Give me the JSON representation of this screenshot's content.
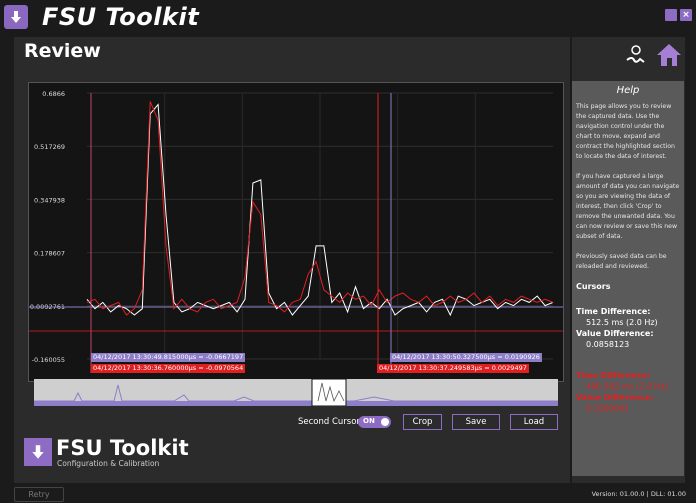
{
  "app": {
    "title": "FSU Toolkit"
  },
  "page": {
    "title": "Review"
  },
  "help": {
    "title": "Help",
    "paragraphs": [
      "This page allows you to review the captured data. Use the navigation control under the chart to move, expand and contract the highlighted section to locate the data of interest.",
      "If you have captured a large amount of data you can navigate so you are viewing the data of interest, then click 'Crop' to remove the unwanted data. You can now review or save this new subset of data.",
      "Previously saved data can be reloaded and reviewed."
    ]
  },
  "cursors": {
    "heading": "Cursors",
    "white": {
      "time_label": "Time Difference:",
      "time_value": "512.5 ms (2.0 Hz)",
      "value_label": "Value Difference:",
      "value_value": "0.0858123"
    },
    "red": {
      "time_label": "Time Difference:",
      "time_value": "480.583 ms (2.0 Hz)",
      "value_label": "Value Difference:",
      "value_value": "0.1000061"
    }
  },
  "chart_data": {
    "type": "line",
    "y_ticks": [
      "0.6866",
      "0.517269",
      "0.347938",
      "0.178607",
      "0.0092761",
      "-0.160055"
    ],
    "ylim": [
      -0.160055,
      0.6866
    ],
    "grid": true,
    "series": [
      {
        "color": "#ffffff",
        "values": [
          0.03,
          0.0,
          0.02,
          -0.01,
          0.01,
          0.0,
          -0.02,
          0.0,
          0.62,
          0.65,
          0.3,
          0.02,
          -0.01,
          0.0,
          0.02,
          0.01,
          0.0,
          0.01,
          0.02,
          -0.01,
          0.03,
          0.4,
          0.41,
          0.05,
          0.0,
          0.02,
          -0.02,
          0.01,
          0.04,
          0.2,
          0.2,
          0.02,
          0.05,
          -0.01,
          0.07,
          0.0,
          0.02,
          0.0,
          0.03,
          -0.02,
          0.0,
          0.01,
          0.02,
          -0.01,
          0.02,
          0.03,
          -0.02,
          0.04,
          0.03,
          0.01,
          0.02,
          0.03,
          0.0,
          0.02,
          0.01,
          0.03,
          0.02,
          0.04,
          0.01,
          0.02
        ]
      },
      {
        "color": "#e02020",
        "values": [
          0.02,
          0.03,
          0.0,
          0.01,
          0.02,
          -0.02,
          0.0,
          0.06,
          0.66,
          0.6,
          0.2,
          0.0,
          0.03,
          0.0,
          -0.01,
          0.02,
          0.03,
          0.0,
          0.01,
          0.02,
          0.1,
          0.34,
          0.3,
          0.02,
          0.01,
          -0.01,
          0.02,
          0.03,
          0.11,
          0.15,
          0.06,
          0.04,
          0.02,
          0.05,
          0.03,
          0.04,
          0.01,
          0.06,
          0.02,
          0.04,
          0.05,
          0.03,
          0.02,
          0.04,
          0.01,
          0.02,
          0.04,
          0.02,
          0.03,
          0.05,
          0.02,
          0.04,
          0.01,
          0.03,
          0.02,
          0.04,
          0.03,
          0.02,
          0.03,
          0.02
        ]
      }
    ]
  },
  "cursor_labels": {
    "left_white": "04/12/2017 13:30:49.815000µs = -0.0667197",
    "left_red": "04/12/2017  13:30:36.760000µs = -0.0970564",
    "right_white": "04/12/2017  13:30:50.327500µs = 0.0190926",
    "right_red": "04/12/2017  13:30:37.249583µs = 0.0029497"
  },
  "controls": {
    "second_cursor_label": "Second Cursor",
    "toggle_state": "ON",
    "crop": "Crop",
    "save": "Save",
    "load": "Load"
  },
  "brand": {
    "name": "FSU Toolkit",
    "subtitle": "Configuration & Calibration"
  },
  "footer": {
    "retry": "Retry",
    "version": "Version: 01.00.0 | DLL: 01.00"
  },
  "colors": {
    "accent": "#8e6cc4",
    "white_cursor": "#8e7ec8",
    "red_cursor": "#e02020"
  }
}
